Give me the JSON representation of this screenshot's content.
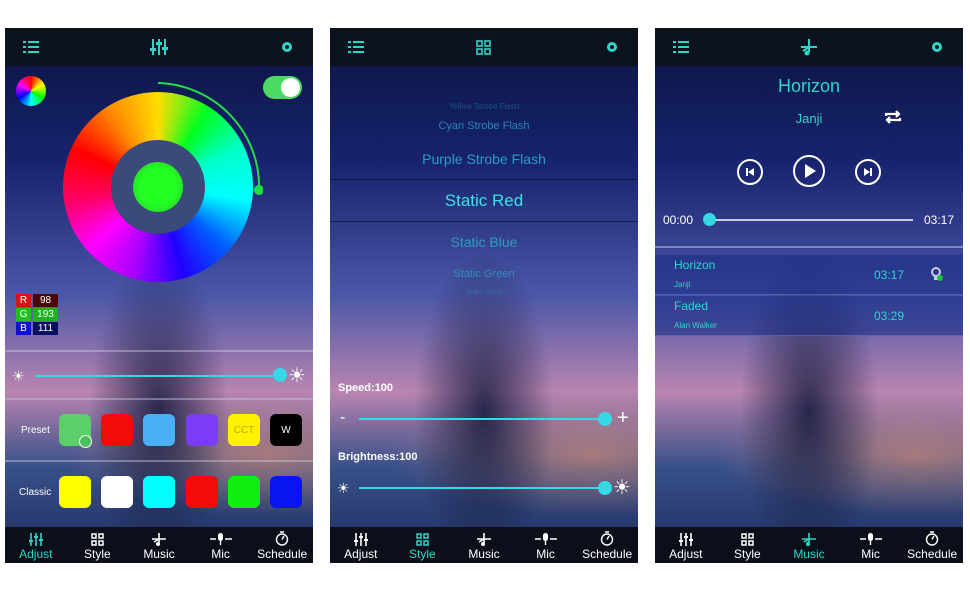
{
  "tabs": [
    {
      "label": "Adjust",
      "icon": "sliders-icon"
    },
    {
      "label": "Style",
      "icon": "grid-icon"
    },
    {
      "label": "Music",
      "icon": "music-note-icon"
    },
    {
      "label": "Mic",
      "icon": "microphone-icon"
    },
    {
      "label": "Schedule",
      "icon": "stopwatch-icon"
    }
  ],
  "accent": "#2fd6c8",
  "adjust": {
    "power_on": true,
    "rgb": {
      "r_label": "R",
      "r": "98",
      "g_label": "G",
      "g": "193",
      "b_label": "B",
      "b": "111"
    },
    "brightness_percent": 100,
    "preset_label": "Preset",
    "presets": [
      {
        "color": "#5ccf6a",
        "text": "",
        "selected": true
      },
      {
        "color": "#f50a0a",
        "text": ""
      },
      {
        "color": "#4ab0f5",
        "text": ""
      },
      {
        "color": "#7a3cf7",
        "text": ""
      },
      {
        "color": "#fff200",
        "text": "CCT"
      },
      {
        "color": "#000000",
        "text": "W"
      }
    ],
    "classic_label": "Classic",
    "classics": [
      "#ffff00",
      "#ffffff",
      "#00ffff",
      "#f50a0a",
      "#11ee11",
      "#0a14f0"
    ]
  },
  "style": {
    "modes": [
      "Yellow Strobe Flash",
      "Cyan Strobe Flash",
      "Purple Strobe Flash",
      "Static Red",
      "Static Blue",
      "Static Green",
      "Static Flash"
    ],
    "selected": "Static Red",
    "speed_label": "Speed:100",
    "speed": 100,
    "minus": "-",
    "plus": "+",
    "brightness_label": "Brightness:100",
    "brightness": 100
  },
  "music": {
    "title": "Horizon",
    "artist": "Janji",
    "elapsed": "00:00",
    "duration": "03:17",
    "progress_percent": 0,
    "playlist": [
      {
        "title": "Horizon",
        "artist": "Janji",
        "duration": "03:17",
        "playing": true
      },
      {
        "title": "Faded",
        "artist": "Alan Walker",
        "duration": "03:29"
      }
    ]
  }
}
